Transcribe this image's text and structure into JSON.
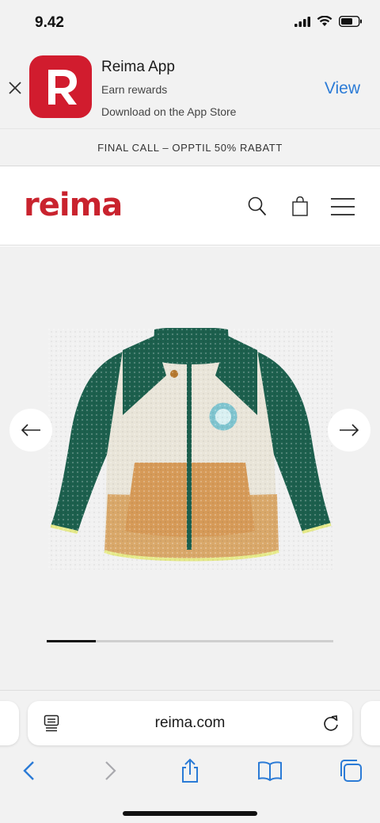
{
  "status_bar": {
    "time": "9.42",
    "icons": [
      "cellular-signal-icon",
      "wifi-icon",
      "battery-icon"
    ]
  },
  "app_banner": {
    "app_name": "Reima App",
    "subtitle": "Earn rewards",
    "store_line": "Download on the App Store",
    "view_label": "View",
    "icon_letter": "R",
    "brand_color": "#d11c2e",
    "link_color": "#2b7bd6"
  },
  "promo": {
    "text": "FINAL CALL – OPPTIL 50% RABATT"
  },
  "header": {
    "logo": "reima",
    "logo_color": "#c9232e",
    "icons": [
      "search-icon",
      "shopping-bag-icon",
      "menu-icon"
    ]
  },
  "product": {
    "image": "fleece-jacket-image",
    "prev_icon": "arrow-left-icon",
    "next_icon": "arrow-right-icon",
    "carousel_progress": 0.17
  },
  "browser": {
    "url": "reima.com",
    "icons": [
      "reader-mode-icon",
      "reload-icon",
      "back-icon",
      "forward-icon",
      "share-icon",
      "bookmarks-icon",
      "tabs-icon"
    ],
    "accent": "#2b7bd6"
  }
}
